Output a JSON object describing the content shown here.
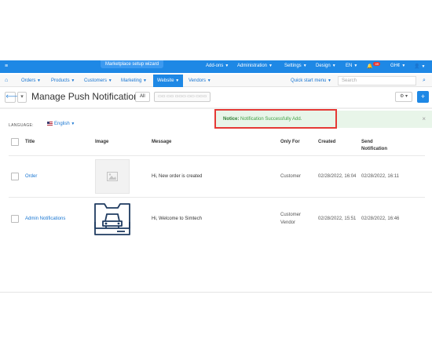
{
  "topbar": {
    "menu_icon": "hamburger-icon",
    "setup_wizard": "Marketplace setup wizard",
    "addons": "Add-ons",
    "administration": "Administration",
    "settings": "Settings",
    "design": "Design",
    "language": "EN",
    "notifications_count": "49",
    "currency": "GH¢",
    "user_icon": "user-icon"
  },
  "nav": {
    "home_icon": "home-icon",
    "items": [
      "Orders",
      "Products",
      "Customers",
      "Marketing",
      "Website",
      "Vendors"
    ],
    "active_item": "Website",
    "quick_start": "Quick start menu",
    "search_placeholder": "Search",
    "search_icon": "search-icon"
  },
  "header": {
    "title": "Manage Push Notification",
    "filter_all": "All",
    "filter_placeholders": "▭▭ ▭▭ ▭▭▭ ▭▭ ▭▭▭"
  },
  "notice": {
    "label": "Notice:",
    "message": "Notification Successfully Add.",
    "close": "×"
  },
  "language": {
    "label": "LANGUAGE:",
    "value": "English"
  },
  "table": {
    "headers": {
      "title": "Title",
      "image": "Image",
      "message": "Message",
      "only_for": "Only For",
      "created": "Created",
      "send_notification_1": "Send",
      "send_notification_2": "Notification"
    },
    "rows": [
      {
        "title": "Order",
        "image": "image-placeholder-icon",
        "message": "Hi, New order is created",
        "only_for": [
          "Customer"
        ],
        "created": "02/28/2022, 16:04",
        "sent": "02/28/2022, 16:11"
      },
      {
        "title": "Admin Notifications",
        "image": "car-mobile-icon",
        "message": "Hi, Welcome to Simtech",
        "only_for": [
          "Customer",
          "Vendor"
        ],
        "created": "02/28/2022, 15:51",
        "sent": "02/28/2022, 16:46"
      }
    ]
  }
}
